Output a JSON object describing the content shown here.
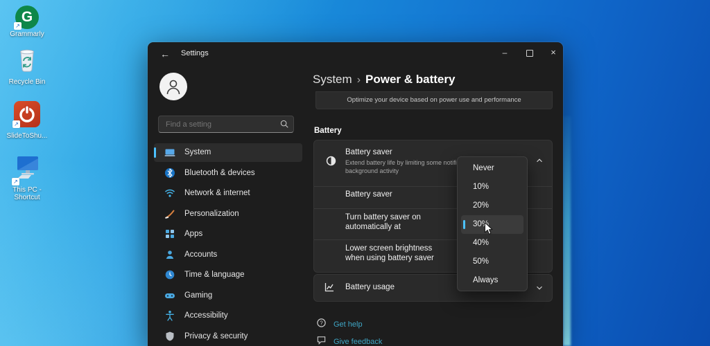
{
  "colors": {
    "accent": "#4cc2ff",
    "link": "#3fa7c6",
    "window_bg": "#1d1d1d",
    "card_bg": "#2a2a2a",
    "desktop_gradient_start": "#38b2ec",
    "desktop_gradient_end": "#0a4cae"
  },
  "icons": {
    "back": "←",
    "minimize": "–",
    "close": "×",
    "shortcut_arrow": "↗"
  },
  "desktop": {
    "icons": [
      {
        "label": "Grammarly",
        "glyph": "G"
      },
      {
        "label": "Recycle Bin"
      },
      {
        "label": "SlideToShu..."
      },
      {
        "label_line1": "This PC -",
        "label_line2": "Shortcut"
      }
    ]
  },
  "window": {
    "title": "Settings"
  },
  "sidebar": {
    "search_placeholder": "Find a setting",
    "items": [
      {
        "label": "System",
        "selected": true
      },
      {
        "label": "Bluetooth & devices"
      },
      {
        "label": "Network & internet"
      },
      {
        "label": "Personalization"
      },
      {
        "label": "Apps"
      },
      {
        "label": "Accounts"
      },
      {
        "label": "Time & language"
      },
      {
        "label": "Gaming"
      },
      {
        "label": "Accessibility"
      },
      {
        "label": "Privacy & security"
      }
    ]
  },
  "main": {
    "breadcrumb": {
      "parent": "System",
      "separator": "›",
      "current": "Power & battery"
    },
    "scrolled_card_text": "Optimize your device based on power use and performance",
    "section_header": "Battery",
    "battery_saver_row": {
      "title": "Battery saver",
      "description_line1": "Extend battery life by limiting some notific",
      "description_line2": "background activity"
    },
    "battery_saver_toggle_label": "Battery saver",
    "auto_row": {
      "line1": "Turn battery saver on",
      "line2": "automatically at"
    },
    "brightness_row": {
      "line1": "Lower screen brightness",
      "line2": "when using battery saver"
    },
    "battery_usage_label": "Battery usage",
    "links": {
      "get_help": "Get help",
      "give_feedback": "Give feedback"
    }
  },
  "dropdown": {
    "options": [
      "Never",
      "10%",
      "20%",
      "30%",
      "40%",
      "50%",
      "Always"
    ],
    "selected": "30%"
  }
}
